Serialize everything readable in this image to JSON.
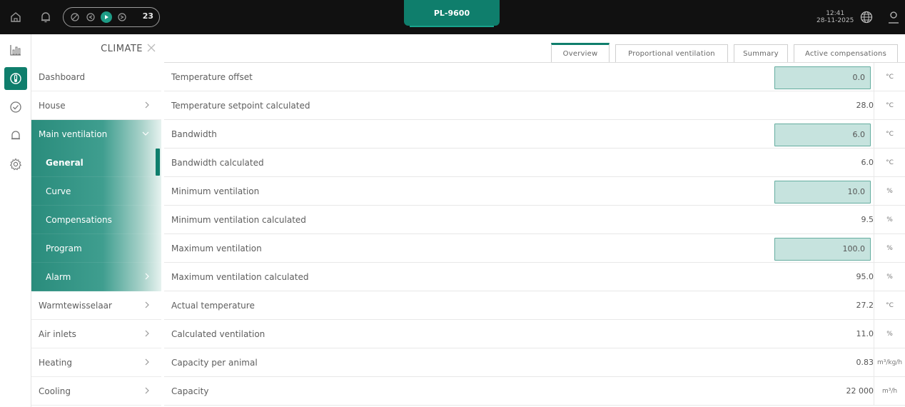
{
  "topbar": {
    "device_title": "PL-9600",
    "status_count": "23",
    "time": "12:41",
    "date": "28-11-2025"
  },
  "sidebar": {
    "title": "CLIMATE",
    "items": [
      {
        "label": "Dashboard"
      },
      {
        "label": "House"
      },
      {
        "label": "Main ventilation"
      },
      {
        "label": "General"
      },
      {
        "label": "Curve"
      },
      {
        "label": "Compensations"
      },
      {
        "label": "Program"
      },
      {
        "label": "Alarm"
      },
      {
        "label": "Warmtewisselaar"
      },
      {
        "label": "Air inlets"
      },
      {
        "label": "Heating"
      },
      {
        "label": "Cooling"
      }
    ]
  },
  "tabs": [
    {
      "label": "Overview"
    },
    {
      "label": "Proportional ventilation"
    },
    {
      "label": "Summary"
    },
    {
      "label": "Active compensations"
    }
  ],
  "rows": [
    {
      "label": "Temperature offset",
      "value": "0.0",
      "unit": "°C"
    },
    {
      "label": "Temperature setpoint calculated",
      "value": "28.0",
      "unit": "°C"
    },
    {
      "label": "Bandwidth",
      "value": "6.0",
      "unit": "°C"
    },
    {
      "label": "Bandwidth calculated",
      "value": "6.0",
      "unit": "°C"
    },
    {
      "label": "Minimum ventilation",
      "value": "10.0",
      "unit": "%"
    },
    {
      "label": "Minimum ventilation calculated",
      "value": "9.5",
      "unit": "%"
    },
    {
      "label": "Maximum ventilation",
      "value": "100.0",
      "unit": "%"
    },
    {
      "label": "Maximum ventilation calculated",
      "value": "95.0",
      "unit": "%"
    },
    {
      "label": "Actual temperature",
      "value": "27.2",
      "unit": "°C"
    },
    {
      "label": "Calculated ventilation",
      "value": "11.0",
      "unit": "%"
    },
    {
      "label": "Capacity per animal",
      "value": "0.83",
      "unit": "m³/kg/h"
    },
    {
      "label": "Capacity",
      "value": "22 000",
      "unit": "m³/h"
    }
  ],
  "colors": {
    "accent": "#0f7e6c",
    "input_bg": "#c6e3de",
    "topbar": "#111111"
  }
}
